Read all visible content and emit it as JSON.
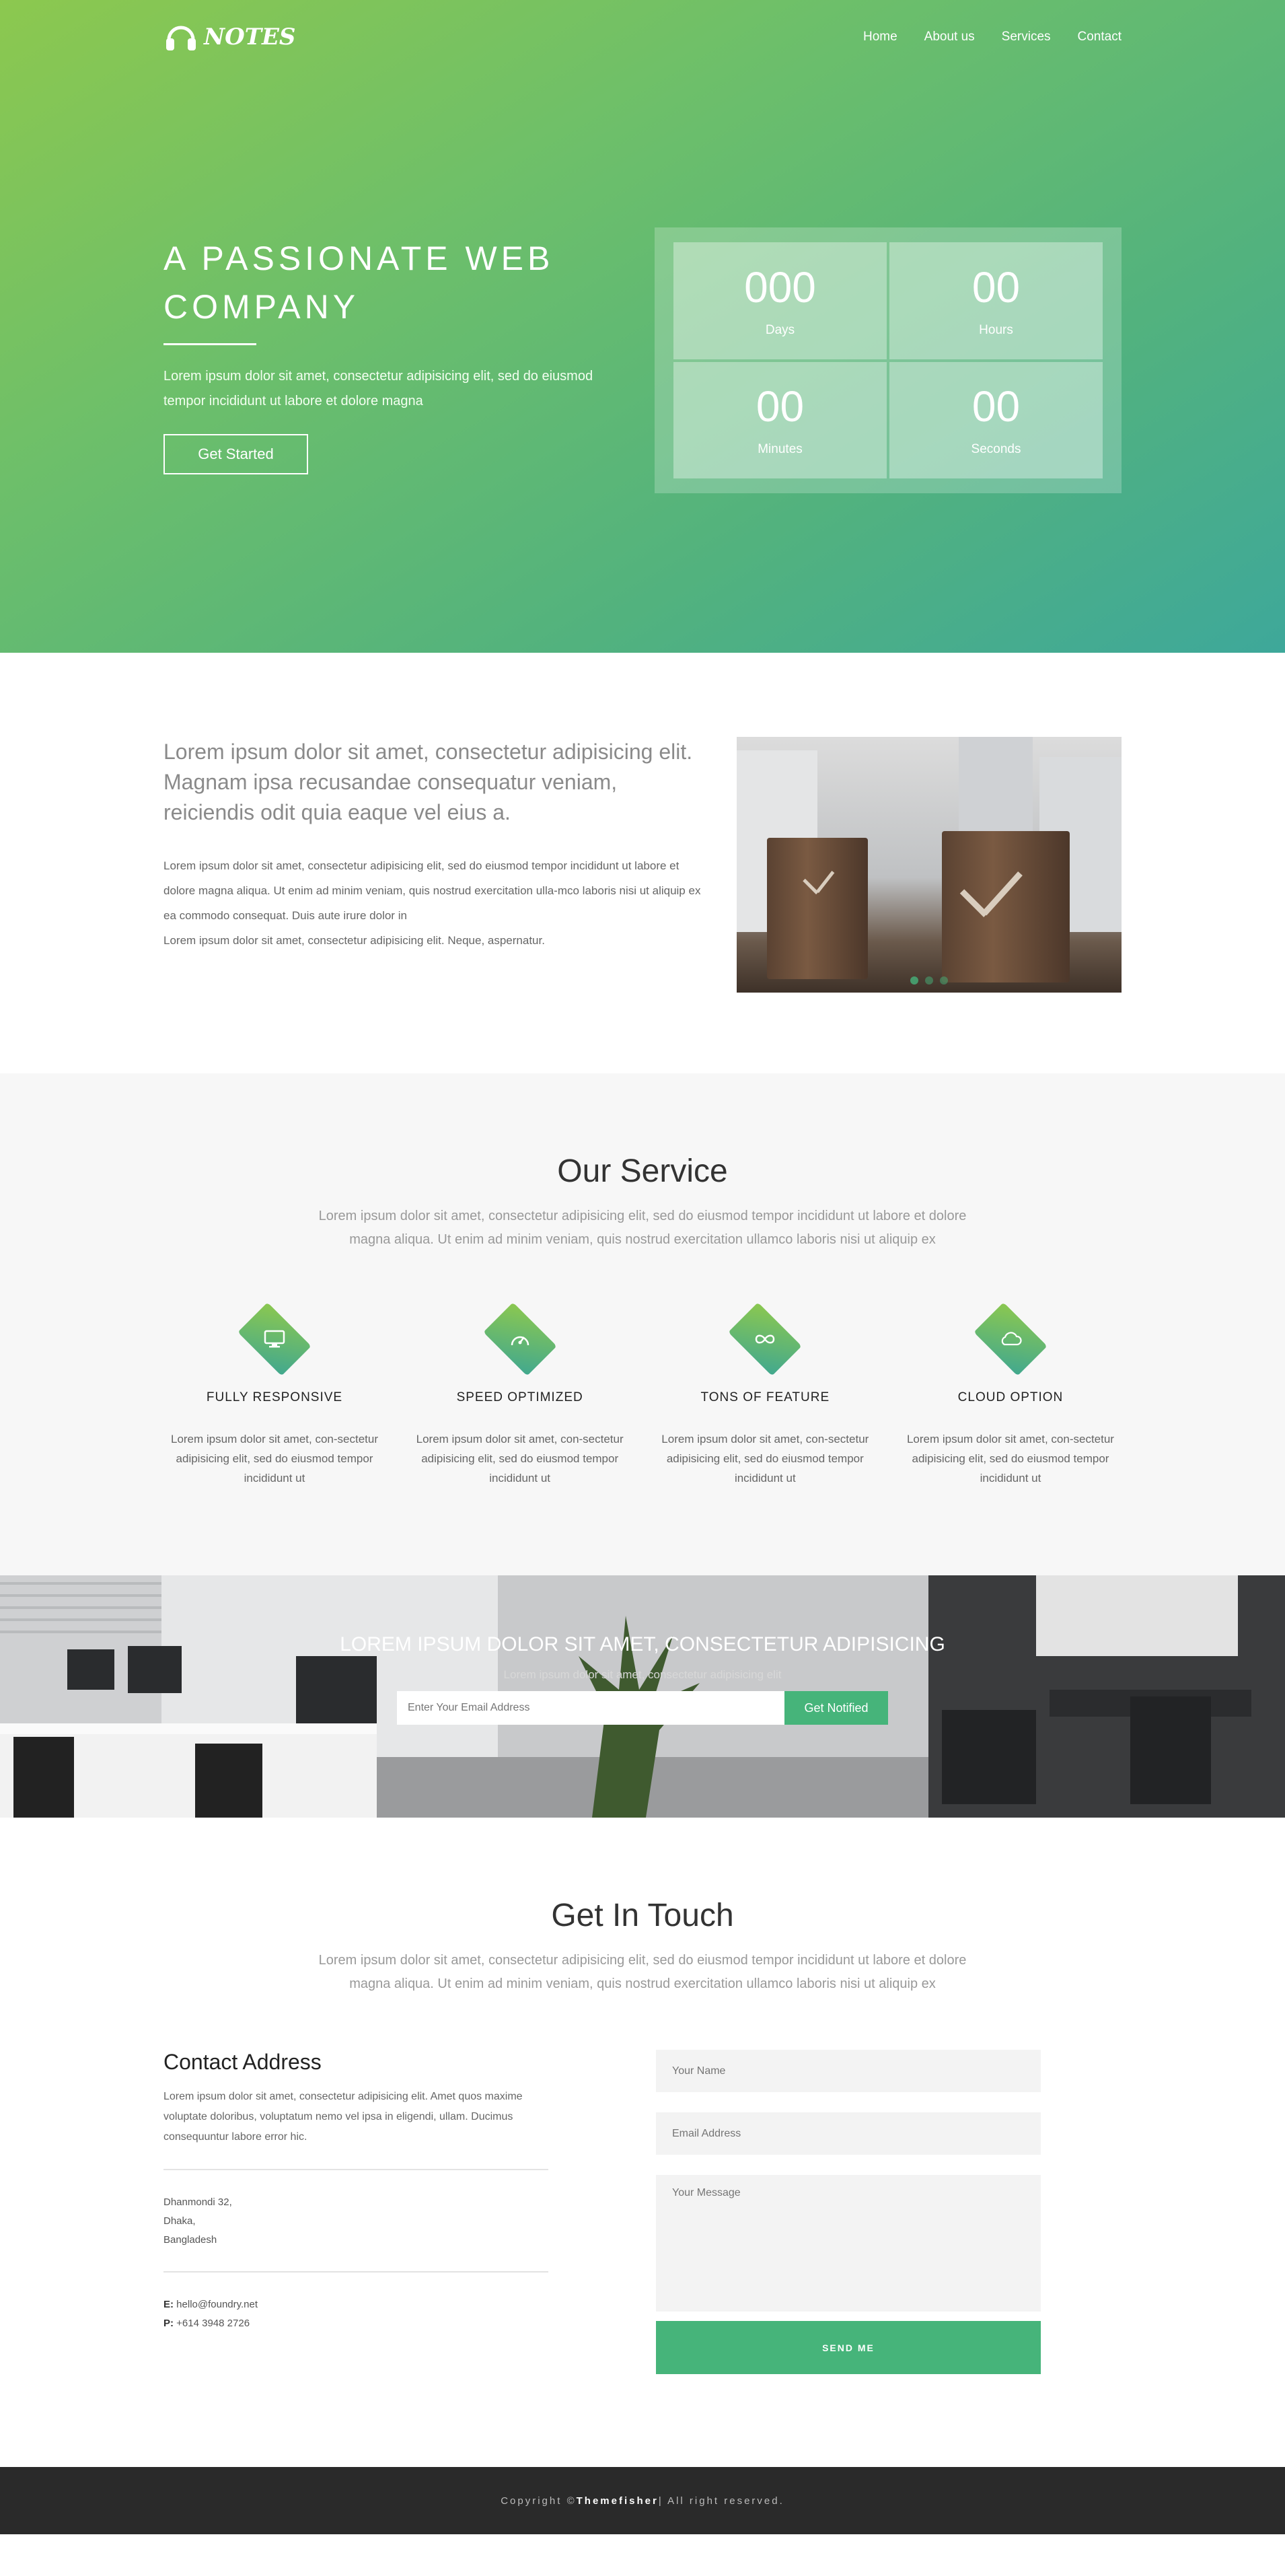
{
  "brand": {
    "name": "NOTES"
  },
  "nav": {
    "items": [
      "Home",
      "About us",
      "Services",
      "Contact"
    ]
  },
  "hero": {
    "title": "A PASSIONATE WEB COMPANY",
    "text": "Lorem ipsum dolor sit amet, consectetur adipisicing elit, sed do eiusmod tempor incididunt ut labore et dolore magna",
    "button": "Get Started",
    "countdown": [
      {
        "value": "000",
        "label": "Days"
      },
      {
        "value": "00",
        "label": "Hours"
      },
      {
        "value": "00",
        "label": "Minutes"
      },
      {
        "value": "00",
        "label": "Seconds"
      }
    ]
  },
  "about": {
    "lead": "Lorem ipsum dolor sit amet, consectetur adipisicing elit. Magnam ipsa recusandae consequatur veniam, reiciendis odit quia eaque vel eius a.",
    "text1": "Lorem ipsum dolor sit amet, consectetur adipisicing elit, sed do eiusmod tempor incididunt ut labore et dolore magna aliqua. Ut enim ad minim veniam, quis nostrud exercitation ulla-mco laboris nisi ut aliquip ex ea commodo consequat. Duis aute irure dolor in",
    "text2": "Lorem ipsum dolor sit amet, consectetur adipisicing elit. Neque, aspernatur."
  },
  "service": {
    "title": "Our Service",
    "subtitle": "Lorem ipsum dolor sit amet, consectetur adipisicing elit, sed do eiusmod tempor incididunt ut labore et dolore magna aliqua. Ut enim ad minim veniam, quis nostrud exercitation ullamco laboris nisi ut aliquip ex",
    "items": [
      {
        "icon": "monitor-icon",
        "title": "FULLY RESPONSIVE",
        "text": "Lorem ipsum dolor sit amet, con-sectetur adipisicing elit, sed do eiusmod tempor incididunt ut"
      },
      {
        "icon": "speedometer-icon",
        "title": "SPEED OPTIMIZED",
        "text": "Lorem ipsum dolor sit amet, con-sectetur adipisicing elit, sed do eiusmod tempor incididunt ut"
      },
      {
        "icon": "infinity-icon",
        "title": "TONS OF FEATURE",
        "text": "Lorem ipsum dolor sit amet, con-sectetur adipisicing elit, sed do eiusmod tempor incididunt ut"
      },
      {
        "icon": "cloud-icon",
        "title": "CLOUD OPTION",
        "text": "Lorem ipsum dolor sit amet, con-sectetur adipisicing elit, sed do eiusmod tempor incididunt ut"
      }
    ]
  },
  "newsletter": {
    "title": "LOREM IPSUM DOLOR SIT AMET, CONSECTETUR ADIPISICING",
    "subtitle": "Lorem ipsum dolor sit amet, consectetur adipisicing elit",
    "placeholder": "Enter Your Email Address",
    "button": "Get Notified"
  },
  "contact": {
    "title": "Get In Touch",
    "subtitle": "Lorem ipsum dolor sit amet, consectetur adipisicing elit, sed do eiusmod tempor incididunt ut labore et dolore magna aliqua. Ut enim ad minim veniam, quis nostrud exercitation ullamco laboris nisi ut aliquip ex",
    "heading": "Contact Address",
    "desc": "Lorem ipsum dolor sit amet, consectetur adipisicing elit. Amet quos maxime voluptate doloribus, voluptatum nemo vel ipsa in eligendi, ullam. Ducimus consequuntur labore error hic.",
    "address": [
      "Dhanmondi 32,",
      "Dhaka,",
      "Bangladesh"
    ],
    "email_label": "E:",
    "email": "hello@foundry.net",
    "phone_label": "P:",
    "phone": "+614 3948 2726",
    "form": {
      "name_placeholder": "Your Name",
      "email_placeholder": "Email Address",
      "message_placeholder": "Your Message",
      "submit": "SEND ME"
    }
  },
  "footer": {
    "prefix": "Copyright © ",
    "brand": "Themefisher",
    "suffix": "| All right reserved."
  },
  "colors": {
    "accent": "#46b47a",
    "hero_start": "#8cc84f",
    "hero_end": "#3ea89a",
    "footer": "#2a2a2a"
  }
}
